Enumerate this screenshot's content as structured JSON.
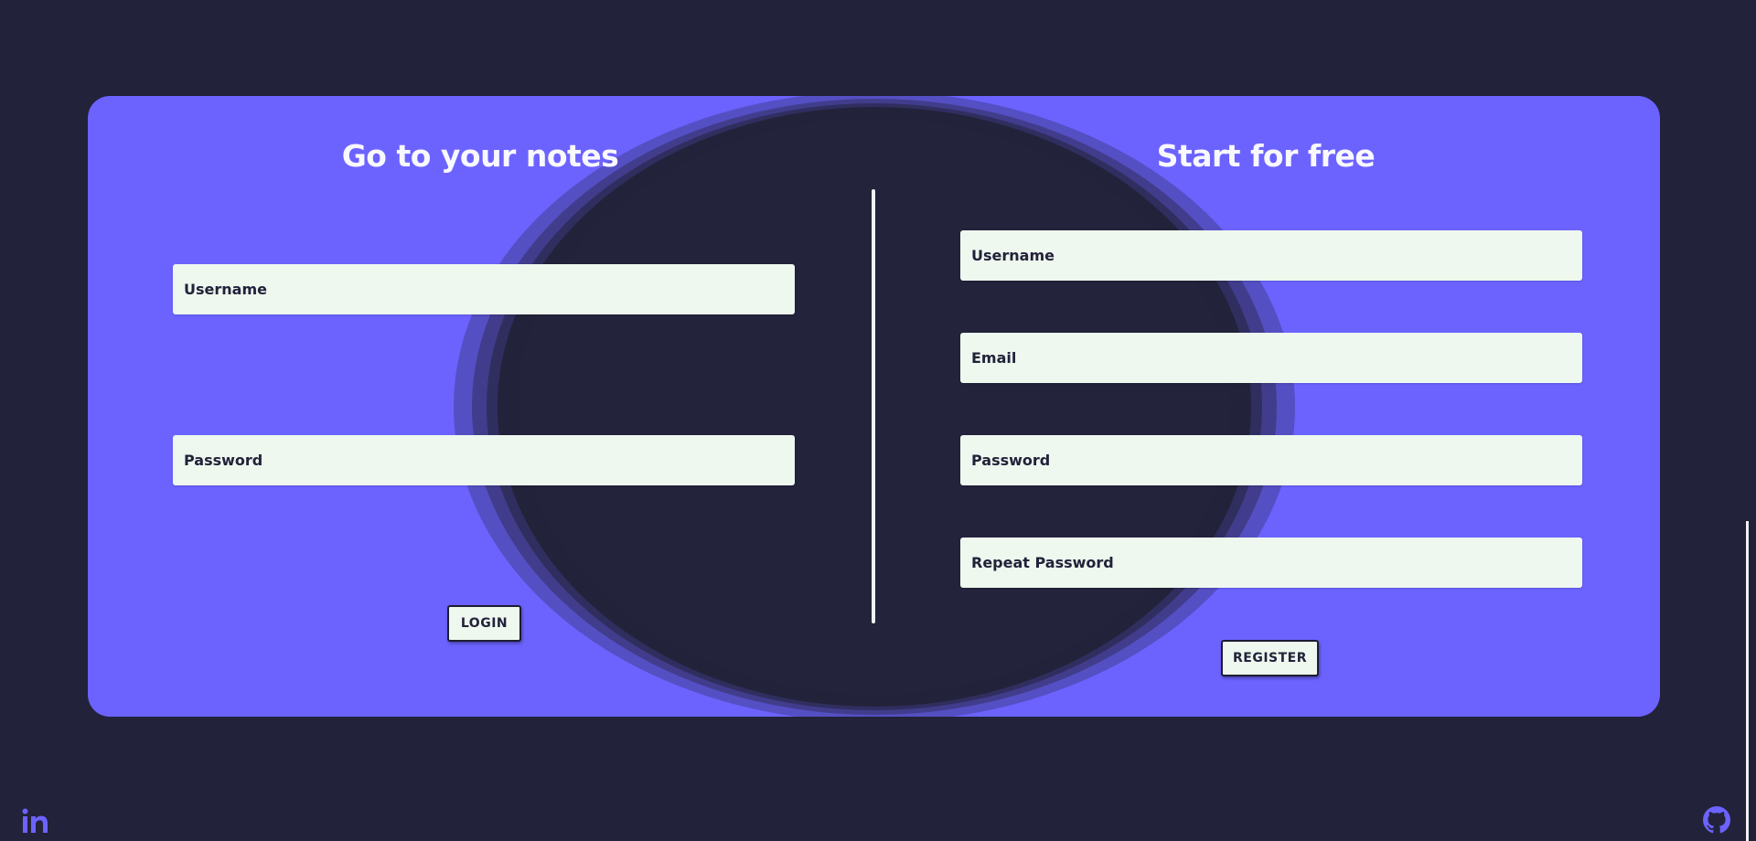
{
  "login": {
    "title": "Go to your notes",
    "username_placeholder": "Username",
    "password_placeholder": "Password",
    "button_label": "LOGIN"
  },
  "register": {
    "title": "Start for free",
    "username_placeholder": "Username",
    "email_placeholder": "Email",
    "password_placeholder": "Password",
    "repeat_password_placeholder": "Repeat Password",
    "button_label": "REGISTER"
  },
  "footer": {
    "left_icon": "linkedin-icon",
    "right_icon": "github-icon"
  },
  "colors": {
    "background": "#22223a",
    "card": "#6c63ff",
    "field": "#eef8ee",
    "text_light": "#f8f8ff"
  }
}
